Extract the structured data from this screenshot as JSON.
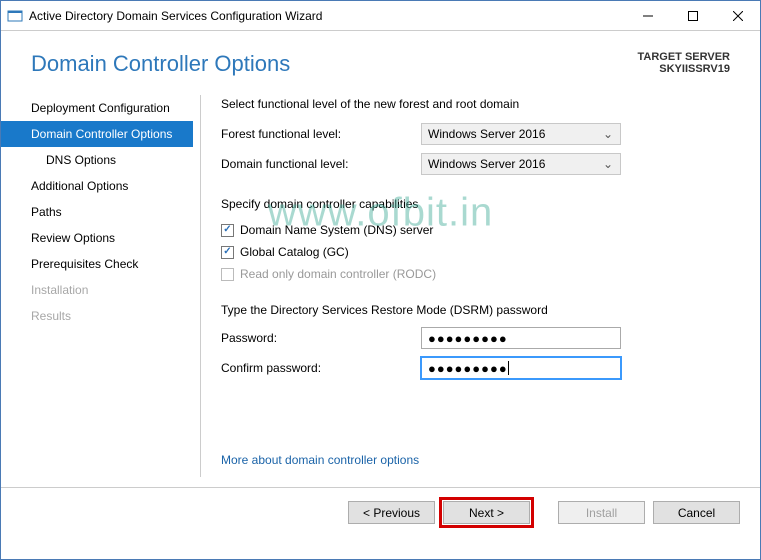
{
  "titlebar": {
    "title": "Active Directory Domain Services Configuration Wizard"
  },
  "header": {
    "page_title": "Domain Controller Options",
    "target_label": "TARGET SERVER",
    "target_value": "SKYIISSRV19"
  },
  "sidebar": {
    "items": [
      {
        "label": "Deployment Configuration",
        "state": ""
      },
      {
        "label": "Domain Controller Options",
        "state": "active"
      },
      {
        "label": "DNS Options",
        "state": "indent"
      },
      {
        "label": "Additional Options",
        "state": ""
      },
      {
        "label": "Paths",
        "state": ""
      },
      {
        "label": "Review Options",
        "state": ""
      },
      {
        "label": "Prerequisites Check",
        "state": ""
      },
      {
        "label": "Installation",
        "state": "disabled"
      },
      {
        "label": "Results",
        "state": "disabled"
      }
    ]
  },
  "main": {
    "intro": "Select functional level of the new forest and root domain",
    "forest_label": "Forest functional level:",
    "forest_value": "Windows Server 2016",
    "domain_label": "Domain functional level:",
    "domain_value": "Windows Server 2016",
    "caps_head": "Specify domain controller capabilities",
    "check_dns": "Domain Name System (DNS) server",
    "check_gc": "Global Catalog (GC)",
    "check_rodc": "Read only domain controller (RODC)",
    "dsrm_head": "Type the Directory Services Restore Mode (DSRM) password",
    "pwd_label": "Password:",
    "pwd_value": "●●●●●●●●●",
    "confirm_label": "Confirm password:",
    "confirm_value": "●●●●●●●●●",
    "link": "More about domain controller options"
  },
  "footer": {
    "previous": "< Previous",
    "next": "Next >",
    "install": "Install",
    "cancel": "Cancel"
  },
  "watermark": "www.ofbit.in"
}
